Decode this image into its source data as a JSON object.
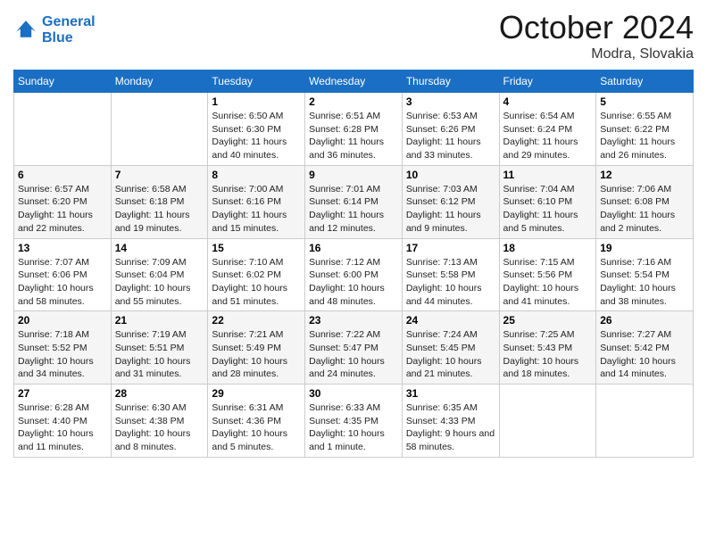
{
  "header": {
    "logo_line1": "General",
    "logo_line2": "Blue",
    "month": "October 2024",
    "location": "Modra, Slovakia"
  },
  "days_of_week": [
    "Sunday",
    "Monday",
    "Tuesday",
    "Wednesday",
    "Thursday",
    "Friday",
    "Saturday"
  ],
  "weeks": [
    [
      {
        "day": "",
        "info": ""
      },
      {
        "day": "",
        "info": ""
      },
      {
        "day": "1",
        "info": "Sunrise: 6:50 AM\nSunset: 6:30 PM\nDaylight: 11 hours and 40 minutes."
      },
      {
        "day": "2",
        "info": "Sunrise: 6:51 AM\nSunset: 6:28 PM\nDaylight: 11 hours and 36 minutes."
      },
      {
        "day": "3",
        "info": "Sunrise: 6:53 AM\nSunset: 6:26 PM\nDaylight: 11 hours and 33 minutes."
      },
      {
        "day": "4",
        "info": "Sunrise: 6:54 AM\nSunset: 6:24 PM\nDaylight: 11 hours and 29 minutes."
      },
      {
        "day": "5",
        "info": "Sunrise: 6:55 AM\nSunset: 6:22 PM\nDaylight: 11 hours and 26 minutes."
      }
    ],
    [
      {
        "day": "6",
        "info": "Sunrise: 6:57 AM\nSunset: 6:20 PM\nDaylight: 11 hours and 22 minutes."
      },
      {
        "day": "7",
        "info": "Sunrise: 6:58 AM\nSunset: 6:18 PM\nDaylight: 11 hours and 19 minutes."
      },
      {
        "day": "8",
        "info": "Sunrise: 7:00 AM\nSunset: 6:16 PM\nDaylight: 11 hours and 15 minutes."
      },
      {
        "day": "9",
        "info": "Sunrise: 7:01 AM\nSunset: 6:14 PM\nDaylight: 11 hours and 12 minutes."
      },
      {
        "day": "10",
        "info": "Sunrise: 7:03 AM\nSunset: 6:12 PM\nDaylight: 11 hours and 9 minutes."
      },
      {
        "day": "11",
        "info": "Sunrise: 7:04 AM\nSunset: 6:10 PM\nDaylight: 11 hours and 5 minutes."
      },
      {
        "day": "12",
        "info": "Sunrise: 7:06 AM\nSunset: 6:08 PM\nDaylight: 11 hours and 2 minutes."
      }
    ],
    [
      {
        "day": "13",
        "info": "Sunrise: 7:07 AM\nSunset: 6:06 PM\nDaylight: 10 hours and 58 minutes."
      },
      {
        "day": "14",
        "info": "Sunrise: 7:09 AM\nSunset: 6:04 PM\nDaylight: 10 hours and 55 minutes."
      },
      {
        "day": "15",
        "info": "Sunrise: 7:10 AM\nSunset: 6:02 PM\nDaylight: 10 hours and 51 minutes."
      },
      {
        "day": "16",
        "info": "Sunrise: 7:12 AM\nSunset: 6:00 PM\nDaylight: 10 hours and 48 minutes."
      },
      {
        "day": "17",
        "info": "Sunrise: 7:13 AM\nSunset: 5:58 PM\nDaylight: 10 hours and 44 minutes."
      },
      {
        "day": "18",
        "info": "Sunrise: 7:15 AM\nSunset: 5:56 PM\nDaylight: 10 hours and 41 minutes."
      },
      {
        "day": "19",
        "info": "Sunrise: 7:16 AM\nSunset: 5:54 PM\nDaylight: 10 hours and 38 minutes."
      }
    ],
    [
      {
        "day": "20",
        "info": "Sunrise: 7:18 AM\nSunset: 5:52 PM\nDaylight: 10 hours and 34 minutes."
      },
      {
        "day": "21",
        "info": "Sunrise: 7:19 AM\nSunset: 5:51 PM\nDaylight: 10 hours and 31 minutes."
      },
      {
        "day": "22",
        "info": "Sunrise: 7:21 AM\nSunset: 5:49 PM\nDaylight: 10 hours and 28 minutes."
      },
      {
        "day": "23",
        "info": "Sunrise: 7:22 AM\nSunset: 5:47 PM\nDaylight: 10 hours and 24 minutes."
      },
      {
        "day": "24",
        "info": "Sunrise: 7:24 AM\nSunset: 5:45 PM\nDaylight: 10 hours and 21 minutes."
      },
      {
        "day": "25",
        "info": "Sunrise: 7:25 AM\nSunset: 5:43 PM\nDaylight: 10 hours and 18 minutes."
      },
      {
        "day": "26",
        "info": "Sunrise: 7:27 AM\nSunset: 5:42 PM\nDaylight: 10 hours and 14 minutes."
      }
    ],
    [
      {
        "day": "27",
        "info": "Sunrise: 6:28 AM\nSunset: 4:40 PM\nDaylight: 10 hours and 11 minutes."
      },
      {
        "day": "28",
        "info": "Sunrise: 6:30 AM\nSunset: 4:38 PM\nDaylight: 10 hours and 8 minutes."
      },
      {
        "day": "29",
        "info": "Sunrise: 6:31 AM\nSunset: 4:36 PM\nDaylight: 10 hours and 5 minutes."
      },
      {
        "day": "30",
        "info": "Sunrise: 6:33 AM\nSunset: 4:35 PM\nDaylight: 10 hours and 1 minute."
      },
      {
        "day": "31",
        "info": "Sunrise: 6:35 AM\nSunset: 4:33 PM\nDaylight: 9 hours and 58 minutes."
      },
      {
        "day": "",
        "info": ""
      },
      {
        "day": "",
        "info": ""
      }
    ]
  ]
}
